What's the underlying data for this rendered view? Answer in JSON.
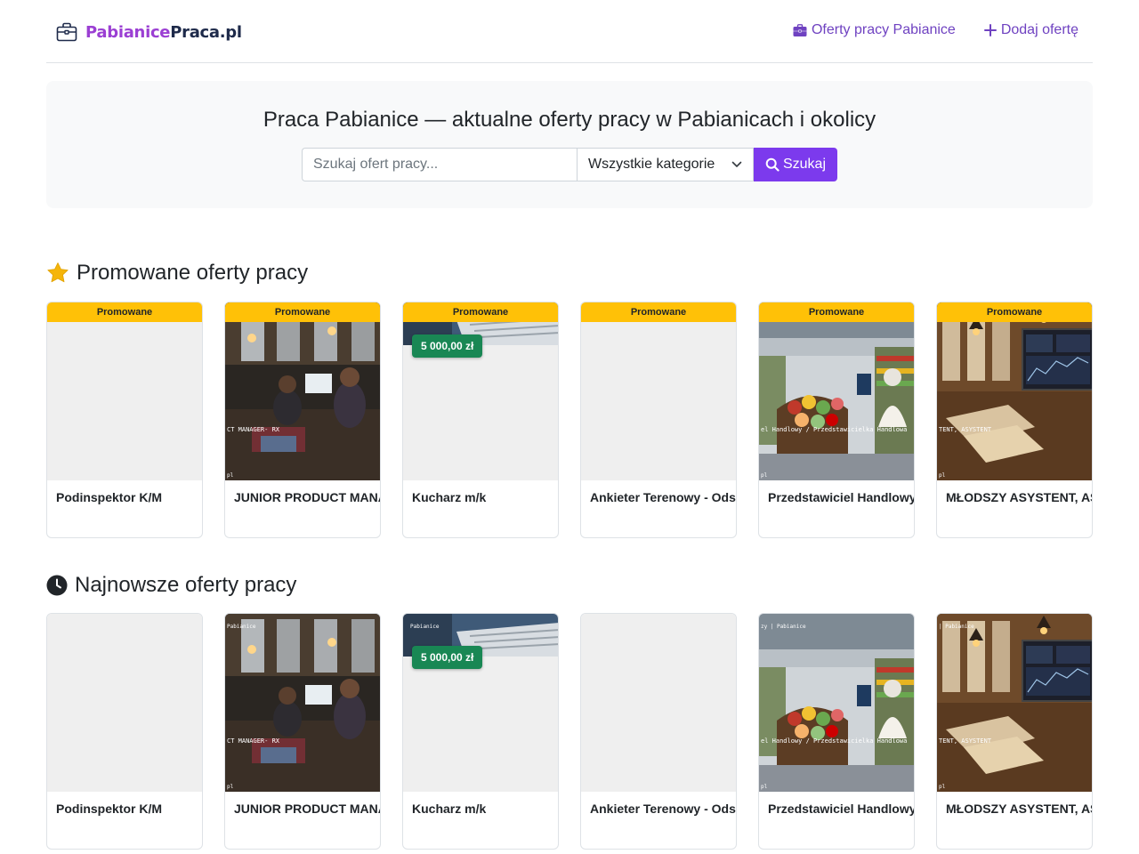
{
  "header": {
    "logo_part1": "Pabianice",
    "logo_part2": "Praca.pl",
    "nav": [
      {
        "label": "Oferty pracy Pabianice",
        "icon": "briefcase-icon"
      },
      {
        "label": "Dodaj ofertę",
        "icon": "plus-icon"
      }
    ]
  },
  "hero": {
    "title": "Praca Pabianice — aktualne oferty pracy w Pabianicach i okolicy",
    "search_placeholder": "Szukaj ofert pracy...",
    "category_selected": "Wszystkie kategorie",
    "search_button": "Szukaj"
  },
  "promoted": {
    "title": "Promowane oferty pracy",
    "icon": "star-icon",
    "badge_label": "Promowane",
    "cards": [
      {
        "title": "Podinspektor K/M",
        "image": "none",
        "price": ""
      },
      {
        "title": "JUNIOR PRODUCT MANAGER",
        "image": "office",
        "price": ""
      },
      {
        "title": "Kucharz m/k",
        "image": "kitchen",
        "price": "5 000,00 zł"
      },
      {
        "title": "Ankieter Terenowy - Odsprzedaż",
        "image": "none",
        "price": ""
      },
      {
        "title": "Przedstawiciel Handlowy",
        "image": "store",
        "price": ""
      },
      {
        "title": "MŁODSZY ASYSTENT, ASYSTENT",
        "image": "desk",
        "price": ""
      }
    ]
  },
  "newest": {
    "title": "Najnowsze oferty pracy",
    "icon": "clock-icon",
    "cards": [
      {
        "title": "Podinspektor K/M",
        "image": "none",
        "price": ""
      },
      {
        "title": "JUNIOR PRODUCT MANAGER",
        "image": "office",
        "price": ""
      },
      {
        "title": "Kucharz m/k",
        "image": "kitchen",
        "price": "5 000,00 zł"
      },
      {
        "title": "Ankieter Terenowy - Odsprzedaż",
        "image": "none",
        "price": ""
      },
      {
        "title": "Przedstawiciel Handlowy",
        "image": "store",
        "price": ""
      },
      {
        "title": "MŁODSZY ASYSTENT, ASYSTENT",
        "image": "desk",
        "price": ""
      }
    ]
  },
  "colors": {
    "brand_purple": "#7c3aed",
    "nav_link": "#6f42c1",
    "promo_ribbon": "#ffc107",
    "price_badge": "#198754"
  }
}
